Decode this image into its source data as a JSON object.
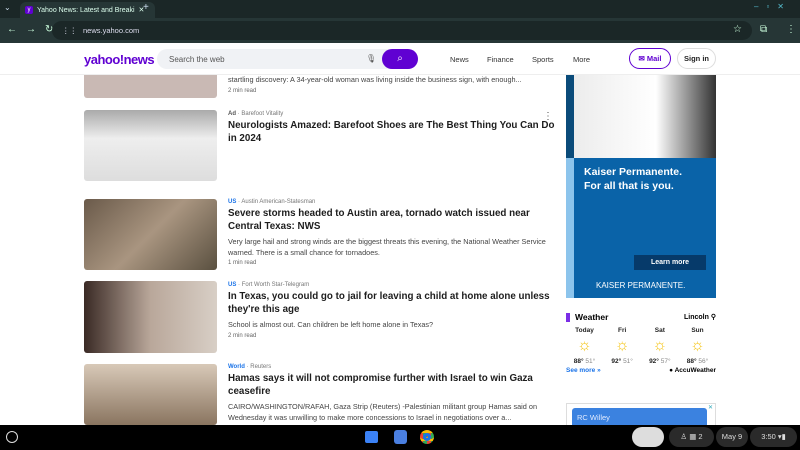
{
  "browser": {
    "tab_title": "Yahoo News: Latest and Breaki",
    "url": "news.yahoo.com"
  },
  "header": {
    "logo": "yahoo!news",
    "search_placeholder": "Search the web",
    "nav": [
      "News",
      "Finance",
      "Sports",
      "More"
    ],
    "mail": "Mail",
    "signin": "Sign in"
  },
  "articles": [
    {
      "desc": "startling discovery: A 34-year-old woman was living inside the business sign, with enough...",
      "read": "2 min read"
    },
    {
      "cat": "Ad",
      "source": "Barefoot Vitality",
      "title": "Neurologists Amazed: Barefoot Shoes are The Best Thing You Can Do in 2024"
    },
    {
      "cat": "US",
      "source": "Austin American-Statesman",
      "title": "Severe storms headed to Austin area, tornado watch issued near Central Texas: NWS",
      "desc": "Very large hail and strong winds are the biggest threats this evening, the National Weather Service warned. There is a small chance for tornadoes.",
      "read": "1 min read"
    },
    {
      "cat": "US",
      "source": "Fort Worth Star-Telegram",
      "title": "In Texas, you could go to jail for leaving a child at home alone unless they're this age",
      "desc": "School is almost out. Can children be left home alone in Texas?",
      "read": "2 min read"
    },
    {
      "cat": "World",
      "source": "Reuters",
      "title": "Hamas says it will not compromise further with Israel to win Gaza ceasefire",
      "desc": "CAIRO/WASHINGTON/RAFAH, Gaza Strip (Reuters) -Palestinian militant group Hamas said on Wednesday it was unwilling to make more concessions to Israel in negotiations over a..."
    }
  ],
  "ad": {
    "headline1": "Kaiser Permanente.",
    "headline2": "For all that is you.",
    "cta": "Learn more",
    "brand": "KAISER PERMANENTE."
  },
  "weather": {
    "title": "Weather",
    "location": "Lincoln",
    "days": [
      {
        "d": "Today",
        "hi": "88°",
        "lo": "51°"
      },
      {
        "d": "Fri",
        "hi": "92°",
        "lo": "51°"
      },
      {
        "d": "Sat",
        "hi": "92°",
        "lo": "57°"
      },
      {
        "d": "Sun",
        "hi": "88°",
        "lo": "56°"
      }
    ],
    "see_more": "See more »",
    "provider": "AccuWeather"
  },
  "ad2": {
    "label": "RC Willey"
  },
  "taskbar": {
    "date": "May 9",
    "time": "3:50",
    "notif": "2"
  }
}
